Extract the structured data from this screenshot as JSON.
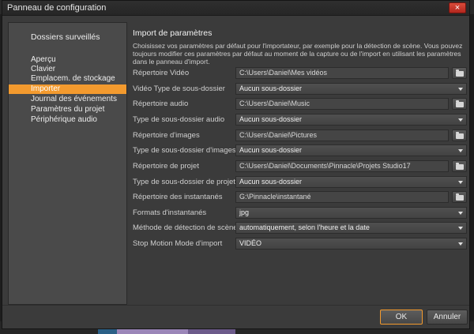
{
  "window": {
    "title": "Panneau de configuration",
    "close_label": "×"
  },
  "sidebar": {
    "items": [
      {
        "label": "Dossiers surveillés",
        "active": false
      },
      {
        "label": "Aperçu",
        "active": false
      },
      {
        "label": "Clavier",
        "active": false
      },
      {
        "label": "Emplacem. de stockage",
        "active": false
      },
      {
        "label": "Importer",
        "active": true
      },
      {
        "label": "Journal des événements",
        "active": false
      },
      {
        "label": "Paramètres du projet",
        "active": false
      },
      {
        "label": "Périphérique audio",
        "active": false
      }
    ]
  },
  "content": {
    "title": "Import de paramètres",
    "description": "Choisissez vos paramètres par défaut pour l'importateur, par exemple pour la détection de scène. Vous pouvez toujours modifier ces paramètres par défaut au moment de la capture ou de l'import en utilisant les paramètres dans le panneau d'import."
  },
  "settings": [
    {
      "label": "Répertoire Vidéo",
      "type": "path",
      "value": "C:\\Users\\Daniel\\Mes vidéos"
    },
    {
      "label": "Vidéo Type de sous-dossier",
      "type": "select",
      "value": "Aucun sous-dossier"
    },
    {
      "label": "Répertoire audio",
      "type": "path",
      "value": "C:\\Users\\Daniel\\Music"
    },
    {
      "label": "Type de sous-dossier audio",
      "type": "select",
      "value": "Aucun sous-dossier"
    },
    {
      "label": "Répertoire d'images",
      "type": "path",
      "value": "C:\\Users\\Daniel\\Pictures"
    },
    {
      "label": "Type de sous-dossier d'images",
      "type": "select",
      "value": "Aucun sous-dossier"
    },
    {
      "label": "Répertoire de projet",
      "type": "path",
      "value": "C:\\Users\\Daniel\\Documents\\Pinnacle\\Projets Studio17"
    },
    {
      "label": "Type de sous-dossier de projet",
      "type": "select",
      "value": "Aucun sous-dossier"
    },
    {
      "label": "Répertoire des instantanés",
      "type": "path",
      "value": "G:\\Pinnacle\\instantané"
    },
    {
      "label": "Formats d'instantanés",
      "type": "select",
      "value": "jpg"
    },
    {
      "label": "Méthode de détection de scène",
      "type": "select",
      "value": "automatiquement, selon l'heure et la date"
    },
    {
      "label": "Stop Motion Mode d'import",
      "type": "select",
      "value": "VIDÉO"
    }
  ],
  "buttons": {
    "ok": "OK",
    "cancel": "Annuler"
  },
  "colors": {
    "accent": "#f39a2e",
    "panel": "#3b3b3b",
    "sidebar": "#4a4a4a"
  }
}
